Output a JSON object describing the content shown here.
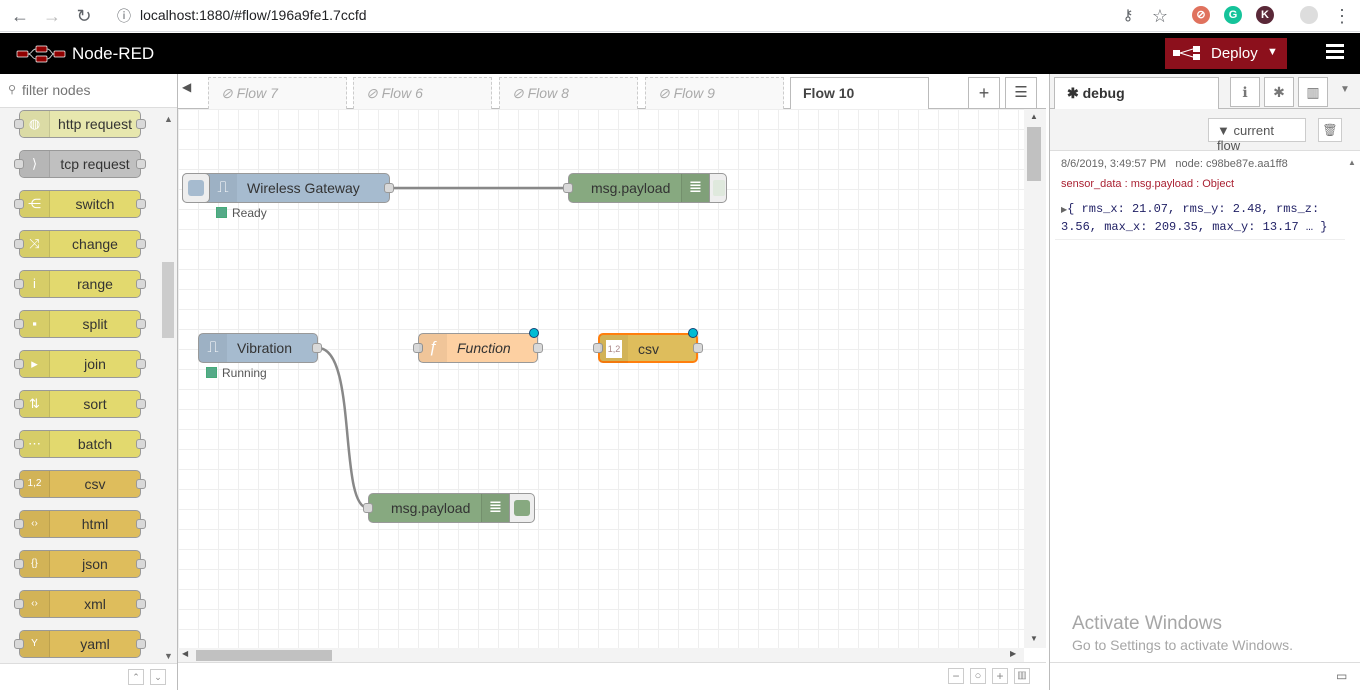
{
  "browser": {
    "url": "localhost:1880/#flow/196a9fe1.7ccfd",
    "ext_k": "K"
  },
  "header": {
    "brand": "Node-RED",
    "deploy_label": "Deploy"
  },
  "palette": {
    "search_placeholder": "filter nodes",
    "nodes": [
      {
        "label": "http request",
        "color": "#e7e7ae",
        "icon": "globe-icon"
      },
      {
        "label": "tcp request",
        "color": "#c0c0c0",
        "icon": "bridge-icon"
      },
      {
        "label": "switch",
        "color": "#e2d96e",
        "icon": "switch-icon"
      },
      {
        "label": "change",
        "color": "#e2d96e",
        "icon": "swap-icon"
      },
      {
        "label": "range",
        "color": "#e2d96e",
        "icon": "range-icon"
      },
      {
        "label": "split",
        "color": "#e2d96e",
        "icon": "split-icon"
      },
      {
        "label": "join",
        "color": "#e2d96e",
        "icon": "join-icon"
      },
      {
        "label": "sort",
        "color": "#e2d96e",
        "icon": "sort-icon"
      },
      {
        "label": "batch",
        "color": "#e2d96e",
        "icon": "batch-icon"
      },
      {
        "label": "csv",
        "color": "#debd5c",
        "icon": "csv-icon"
      },
      {
        "label": "html",
        "color": "#debd5c",
        "icon": "html-icon"
      },
      {
        "label": "json",
        "color": "#debd5c",
        "icon": "json-icon"
      },
      {
        "label": "xml",
        "color": "#debd5c",
        "icon": "xml-icon"
      },
      {
        "label": "yaml",
        "color": "#debd5c",
        "icon": "yaml-icon"
      }
    ],
    "icon_glyphs": {
      "globe-icon": "◍",
      "bridge-icon": "⟩",
      "switch-icon": "⋲",
      "swap-icon": "⤨",
      "range-icon": "i",
      "split-icon": "▪",
      "join-icon": "▸",
      "sort-icon": "⇅",
      "batch-icon": "⋯",
      "csv-icon": "1,2",
      "html-icon": "‹›",
      "json-icon": "{}",
      "xml-icon": "‹›",
      "yaml-icon": "Y"
    }
  },
  "tabs": [
    {
      "label": "Flow 7",
      "active": false
    },
    {
      "label": "Flow 6",
      "active": false
    },
    {
      "label": "Flow 8",
      "active": false
    },
    {
      "label": "Flow 9",
      "active": false
    },
    {
      "label": "Flow 10",
      "active": true
    }
  ],
  "flow": {
    "wireless_gateway": {
      "label": "Wireless Gateway",
      "status": "Ready"
    },
    "debug1": {
      "label": "msg.payload"
    },
    "vibration": {
      "label": "Vibration",
      "status": "Running"
    },
    "function": {
      "label": "Function"
    },
    "csv": {
      "label": "csv",
      "csv_icon_text": "1,2"
    },
    "debug2": {
      "label": "msg.payload"
    }
  },
  "colors": {
    "header_bg": "#000000",
    "deploy_bg": "#8c101c",
    "input_node": "#a6bbcf",
    "debug_node": "#87a980",
    "function_node": "#fdd0a2",
    "csv_node": "#debd5c",
    "selected_border": "#ff7f0e",
    "status_green": "#5a8"
  },
  "sidebar": {
    "tab_label": "debug",
    "filter_label": "current flow",
    "message": {
      "timestamp": "8/6/2019, 3:49:57 PM",
      "node": "node: c98be87e.aa1ff8",
      "topic": "sensor_data : msg.payload : Object",
      "object": "{ rms_x: 21.07, rms_y: 2.48, rms_z: 3.56, max_x: 209.35, max_y: 13.17 … }"
    }
  },
  "watermark": {
    "line1": "Activate Windows",
    "line2": "Go to Settings to activate Windows."
  }
}
